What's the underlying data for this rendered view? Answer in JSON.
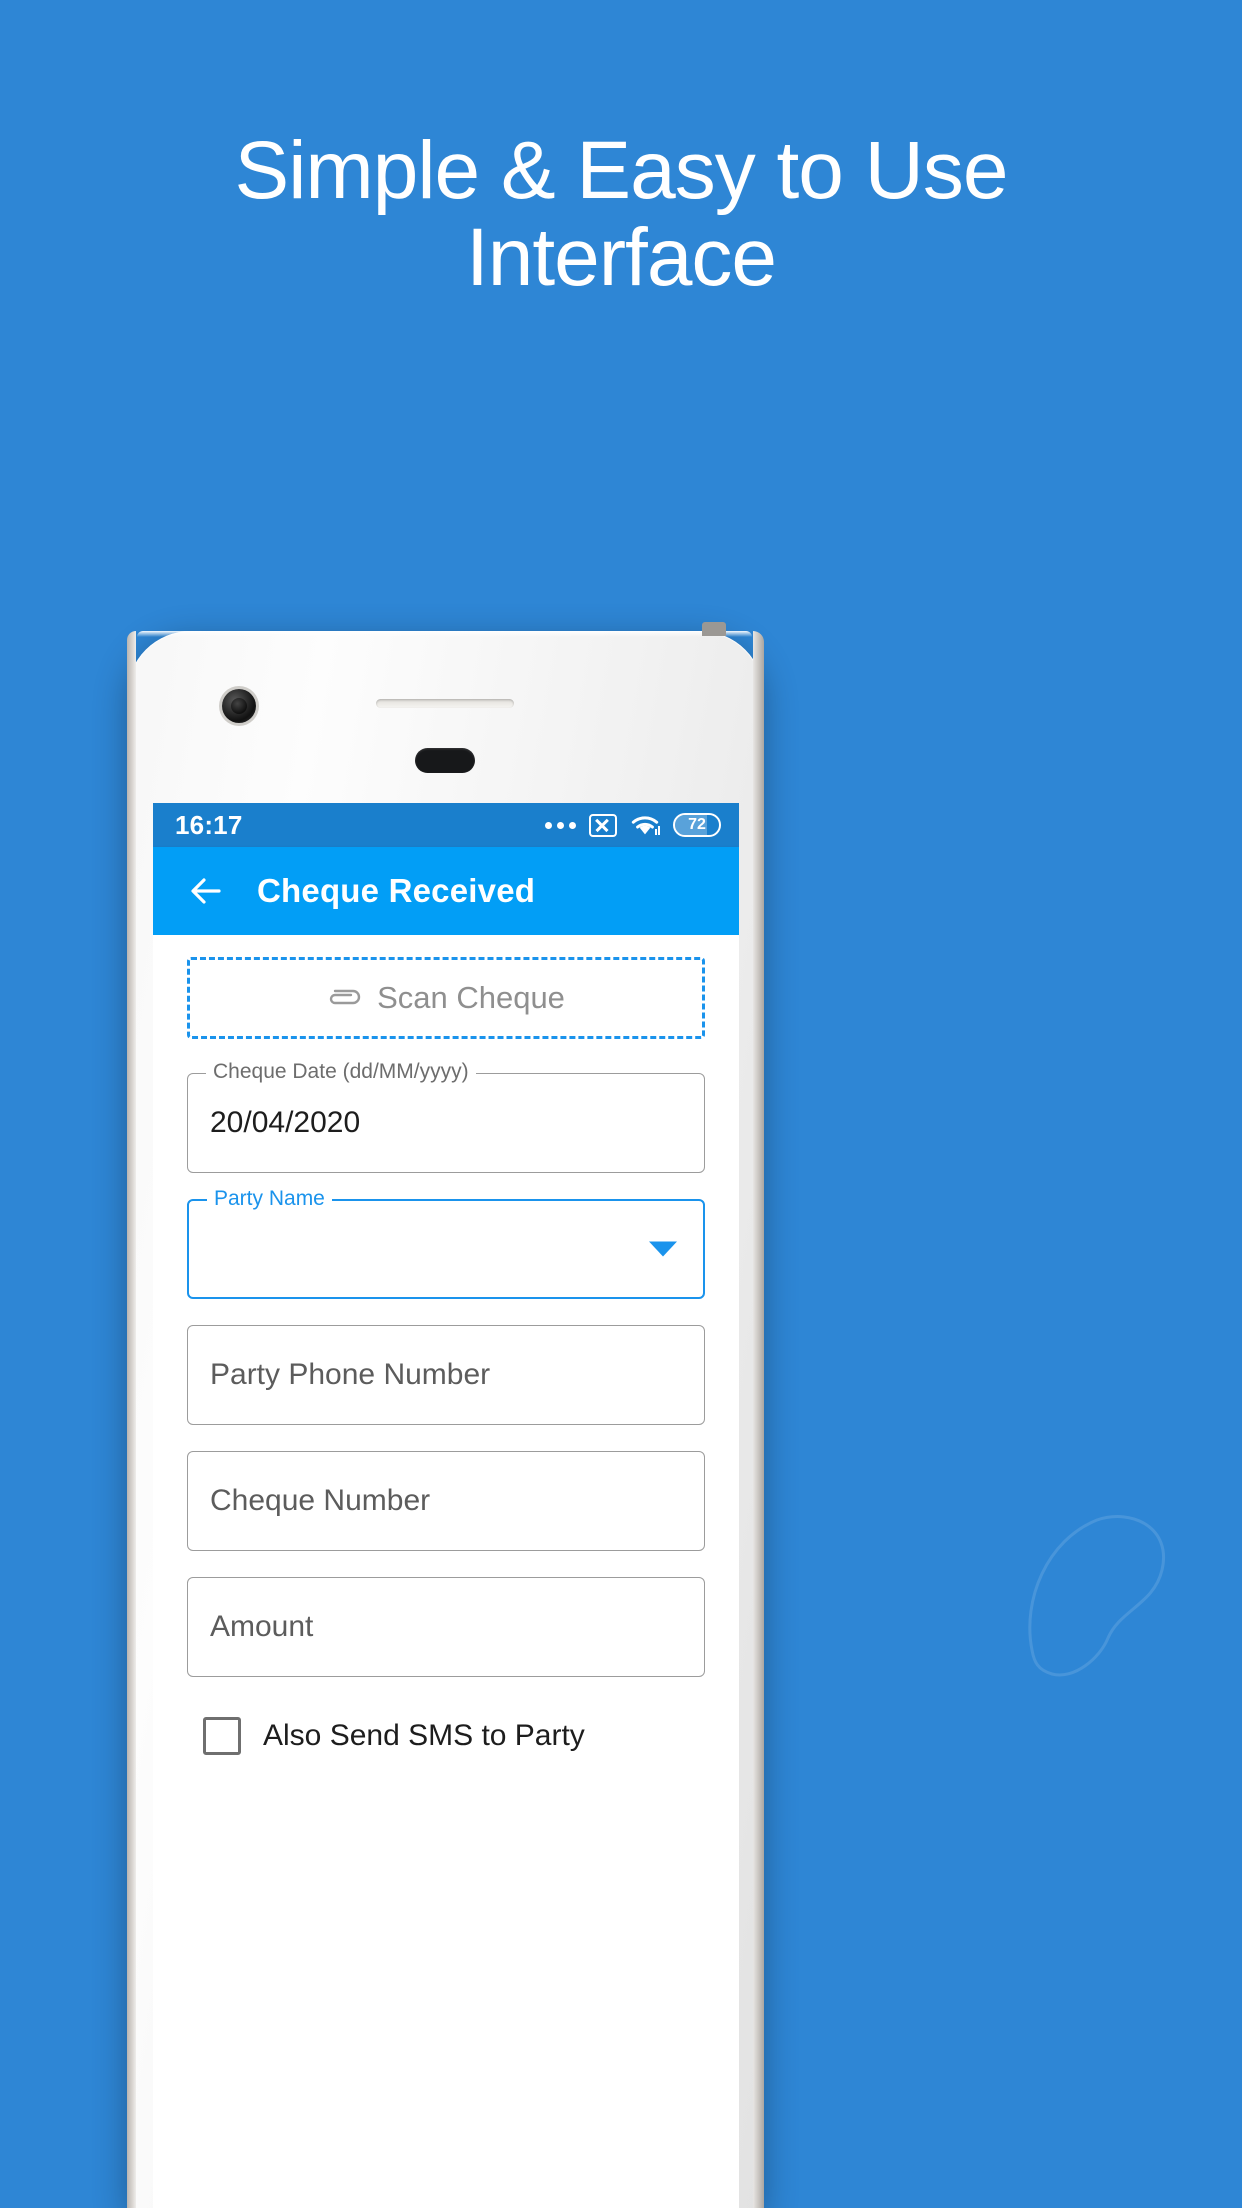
{
  "promo": {
    "headline_line1": "Simple & Easy to Use",
    "headline_line2": "Interface",
    "background_color": "#2e86d5",
    "text_color": "#ffffff"
  },
  "phone": {
    "statusbar": {
      "time": "16:17",
      "battery_percent": "72",
      "icons": [
        "more-dots-icon",
        "no-sim-icon",
        "wifi-icon",
        "battery-icon"
      ],
      "background_color": "#1a7fcc"
    },
    "appbar": {
      "back_label": "Back",
      "title": "Cheque Received",
      "background_color": "#029ef6"
    },
    "form": {
      "scan": {
        "label": "Scan Cheque",
        "icon": "paperclip-icon",
        "border_color": "#1a93ec"
      },
      "cheque_date": {
        "legend": "Cheque Date (dd/MM/yyyy)",
        "value": "20/04/2020"
      },
      "party_name": {
        "legend": "Party Name",
        "value": "",
        "accent_color": "#1a93ec"
      },
      "party_phone": {
        "placeholder": "Party Phone Number",
        "value": ""
      },
      "cheque_number": {
        "placeholder": "Cheque Number",
        "value": ""
      },
      "amount": {
        "placeholder": "Amount",
        "value": ""
      },
      "sms_checkbox": {
        "label": "Also Send SMS to Party",
        "checked": false
      }
    }
  }
}
